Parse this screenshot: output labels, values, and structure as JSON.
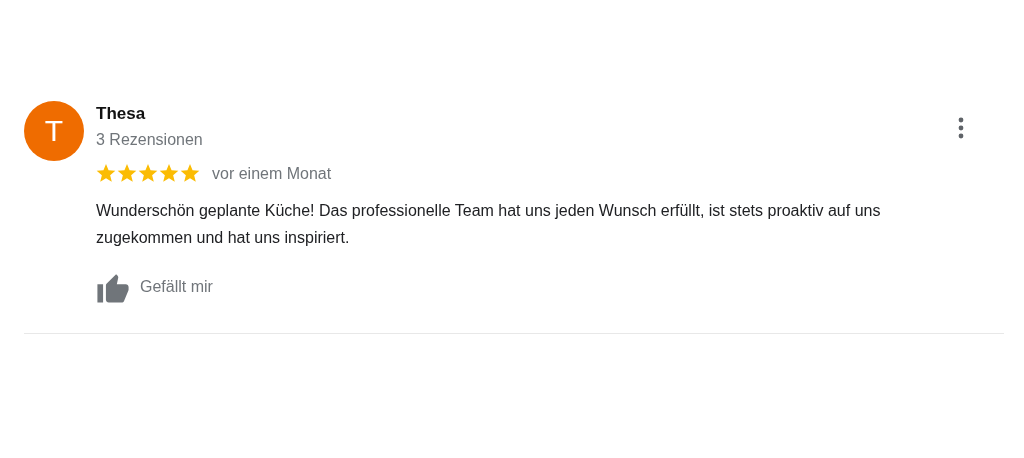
{
  "review": {
    "avatar_letter": "T",
    "author": "Thesa",
    "review_count": "3 Rezensionen",
    "stars": 5,
    "time": "vor einem Monat",
    "text": "Wunderschön geplante Küche! Das professionelle Team hat uns jeden Wunsch erfüllt, ist stets proaktiv auf uns zugekommen und hat uns inspiriert.",
    "like_label": "Gefällt mir"
  }
}
